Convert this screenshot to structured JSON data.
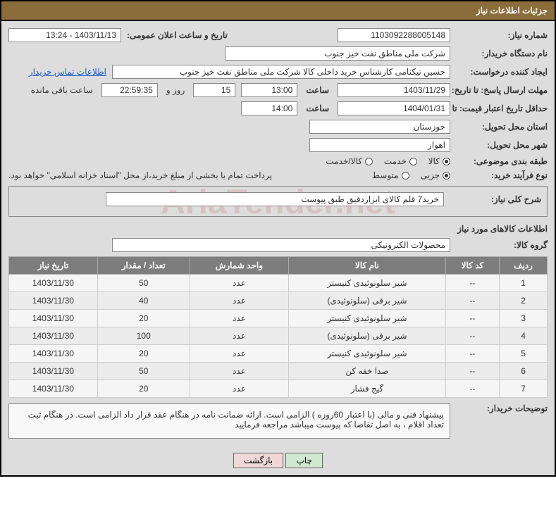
{
  "header": {
    "title": "جزئیات اطلاعات نیاز"
  },
  "watermark": "AriaTender.net",
  "fields": {
    "need_no_label": "شماره نیاز:",
    "need_no": "1103092288005148",
    "announce_label": "تاریخ و ساعت اعلان عمومی:",
    "announce_val": "1403/11/13 - 13:24",
    "buyer_org_label": "نام دستگاه خریدار:",
    "buyer_org": "شرکت ملی مناطق نفت خیز جنوب",
    "request_creator_label": "ایجاد کننده درخواست:",
    "request_creator": "حسین  نیکنامی  کارشناس خرید داخلی کالا شرکت ملی مناطق نفت خیز جنوب",
    "contact_link": "اطلاعات تماس خریدار",
    "deadline_label": "مهلت ارسال پاسخ: تا تاریخ:",
    "deadline_date": "1403/11/29",
    "time_label": "ساعت",
    "deadline_time": "13:00",
    "days_val": "15",
    "days_and": "روز و",
    "countdown": "22:59:35",
    "remaining": "ساعت باقی مانده",
    "validity_label": "حداقل تاریخ اعتبار قیمت: تا تاریخ:",
    "validity_date": "1404/01/31",
    "validity_time": "14:00",
    "province_label": "استان محل تحویل:",
    "province": "خوزستان",
    "city_label": "شهر محل تحویل:",
    "city": "اهواز",
    "category_label": "طبقه بندی موضوعی:",
    "cat_goods": "کالا",
    "cat_service": "خدمت",
    "cat_both": "کالا/خدمت",
    "process_label": "نوع فرآیند خرید:",
    "proc_small": "جزیی",
    "proc_medium": "متوسط",
    "process_note": "پرداخت تمام یا بخشی از مبلغ خرید،از محل \"اسناد خزانه اسلامی\" خواهد بود.",
    "desc_label": "شرح کلی نیاز:",
    "desc_val": "خرید7 قلم کالای ابزاردقیق طبق پیوست",
    "goods_info_title": "اطلاعات کالاهای مورد نیاز",
    "group_label": "گروه کالا:",
    "group_val": "محصولات الکترونیکی",
    "notes_label": "توضیحات خریدار:",
    "notes_val": "پیشنهاد فنی و مالی (با اعتبار 60روزه ) الزامی است. ارائه ضمانت نامه در هنگام عقد قرار داد الزامی است. در هنگام ثبت تعداد اقلام ،  به اصل تقاضا که پیوست میباشد مراجعه  فرمایید"
  },
  "table": {
    "headers": {
      "row": "ردیف",
      "code": "کد کالا",
      "name": "نام کالا",
      "unit": "واحد شمارش",
      "qty": "تعداد / مقدار",
      "date": "تاریخ نیاز"
    },
    "rows": [
      {
        "n": "1",
        "code": "--",
        "name": "شیر سلونوئیدی کنیستر",
        "unit": "عدد",
        "qty": "50",
        "date": "1403/11/30"
      },
      {
        "n": "2",
        "code": "--",
        "name": "شیر برقی (سلونوئیدی)",
        "unit": "عدد",
        "qty": "40",
        "date": "1403/11/30"
      },
      {
        "n": "3",
        "code": "--",
        "name": "شیر سلونوئیدی کنیستر",
        "unit": "عدد",
        "qty": "20",
        "date": "1403/11/30"
      },
      {
        "n": "4",
        "code": "--",
        "name": "شیر برقی (سلونوئیدی)",
        "unit": "عدد",
        "qty": "100",
        "date": "1403/11/30"
      },
      {
        "n": "5",
        "code": "--",
        "name": "شیر سلونوئیدی کنیستر",
        "unit": "عدد",
        "qty": "20",
        "date": "1403/11/30"
      },
      {
        "n": "6",
        "code": "--",
        "name": "صدا خفه کن",
        "unit": "عدد",
        "qty": "50",
        "date": "1403/11/30"
      },
      {
        "n": "7",
        "code": "--",
        "name": "گیج فشار",
        "unit": "عدد",
        "qty": "20",
        "date": "1403/11/30"
      }
    ]
  },
  "buttons": {
    "print": "چاپ",
    "back": "بازگشت"
  }
}
